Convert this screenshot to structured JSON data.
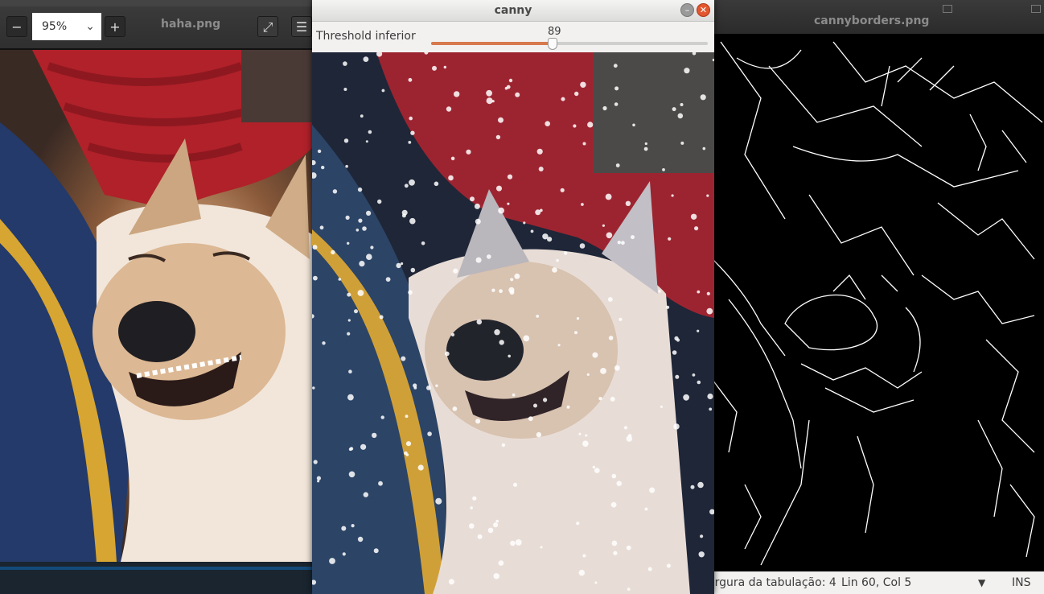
{
  "left_viewer": {
    "title": "haha.png",
    "zoom": "95%",
    "zoom_out_icon": "minus",
    "zoom_in_icon": "plus",
    "fullscreen_icon": "expand",
    "menu_icon": "hamburger"
  },
  "canny_window": {
    "title": "canny",
    "trackbar_label": "Threshold inferior",
    "trackbar_value": "89",
    "trackbar_fraction": 0.44,
    "accent_color": "#d8794d"
  },
  "right_window": {
    "title": "cannyborders.png",
    "status": {
      "tab_width": "argura da tabulação: 4",
      "position": "Lin 60, Col 5",
      "mode": "INS"
    }
  },
  "colors": {
    "fill_accent": "#d8794d",
    "close_button": "#e2572e"
  }
}
